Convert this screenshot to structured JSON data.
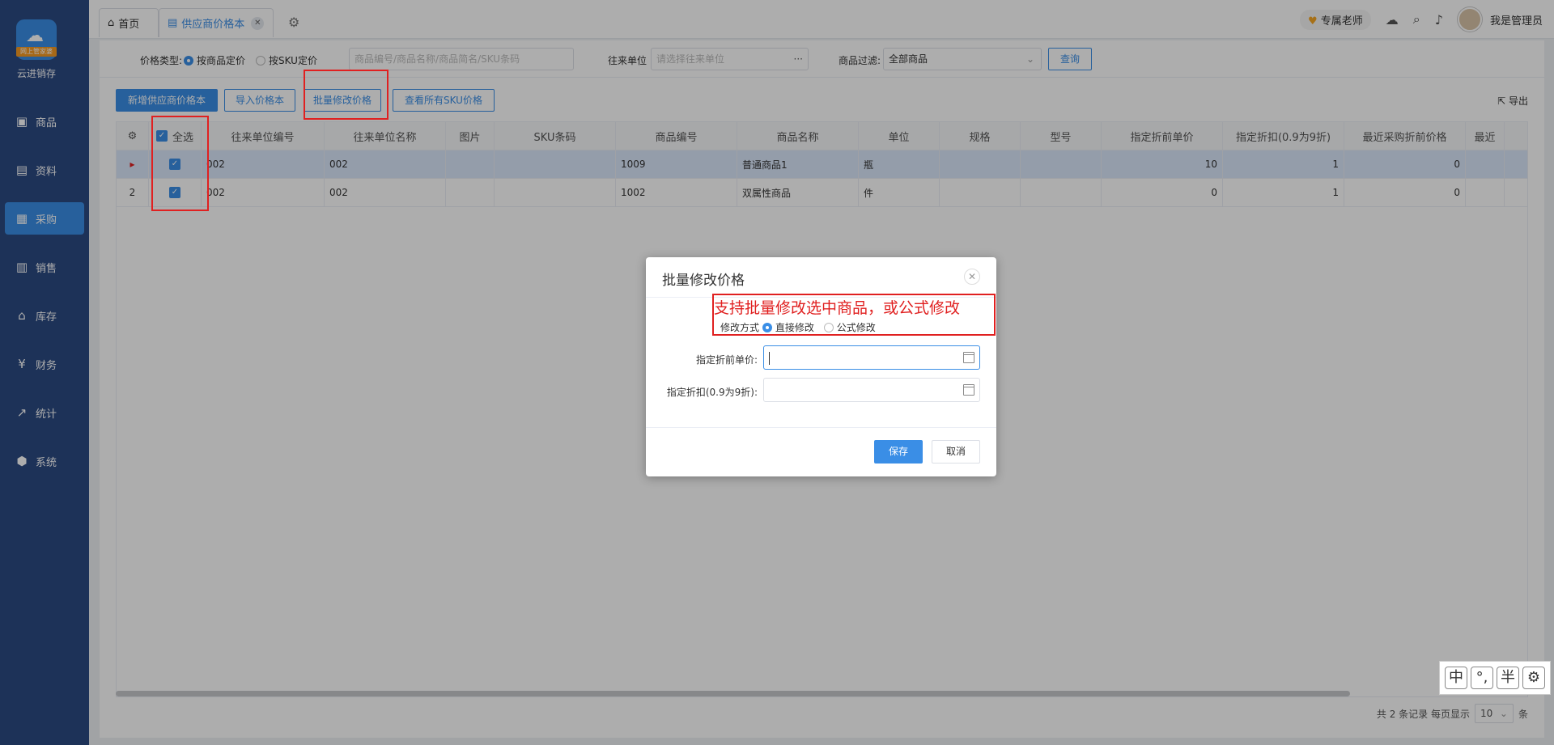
{
  "sidebar": {
    "logo_tag": "网上管家婆",
    "brand": "云进销存",
    "items": [
      {
        "label": "商品",
        "icon": "bag-icon"
      },
      {
        "label": "资料",
        "icon": "doc-icon"
      },
      {
        "label": "采购",
        "icon": "purchase-icon",
        "active": true
      },
      {
        "label": "销售",
        "icon": "chart-icon"
      },
      {
        "label": "库存",
        "icon": "warehouse-icon"
      },
      {
        "label": "财务",
        "icon": "finance-icon"
      },
      {
        "label": "统计",
        "icon": "stats-icon"
      },
      {
        "label": "系统",
        "icon": "system-icon"
      }
    ]
  },
  "tabs": {
    "home": "首页",
    "current": "供应商价格本"
  },
  "topbar": {
    "teacher": "专属老师",
    "user": "我是管理员"
  },
  "filter": {
    "price_type_label": "价格类型:",
    "opt_goods": "按商品定价",
    "opt_sku": "按SKU定价",
    "search_placeholder": "商品编号/商品名称/商品简名/SKU条码",
    "unit_label": "往来单位",
    "unit_placeholder": "请选择往来单位",
    "goods_filter_label": "商品过滤:",
    "goods_filter_value": "全部商品",
    "query": "查询"
  },
  "toolbar": {
    "add": "新增供应商价格本",
    "import": "导入价格本",
    "batch": "批量修改价格",
    "view_sku": "查看所有SKU价格",
    "export": "导出"
  },
  "table": {
    "select_all": "全选",
    "headers": [
      "往来单位编号",
      "往来单位名称",
      "图片",
      "SKU条码",
      "商品编号",
      "商品名称",
      "单位",
      "规格",
      "型号",
      "指定折前单价",
      "指定折扣(0.9为9折)",
      "最近采购折前价格",
      "最近"
    ],
    "rows": [
      {
        "idx": "▸",
        "unit_no": "002",
        "unit_name": "002",
        "sku": "",
        "code": "1009",
        "name": "普通商品1",
        "unit": "瓶",
        "spec": "",
        "model": "",
        "price": "10",
        "discount": "1",
        "last": "0"
      },
      {
        "idx": "2",
        "unit_no": "002",
        "unit_name": "002",
        "sku": "",
        "code": "1002",
        "name": "双属性商品",
        "unit": "件",
        "spec": "",
        "model": "",
        "price": "0",
        "discount": "1",
        "last": "0"
      }
    ]
  },
  "footer": {
    "total": "共 2 条记录",
    "per_page_label": "每页显示",
    "per_page": "10",
    "unit": "条"
  },
  "dialog": {
    "title": "批量修改价格",
    "annotation": "支持批量修改选中商品，或公式修改",
    "mode_label": "修改方式",
    "mode_direct": "直接修改",
    "mode_formula": "公式修改",
    "price_label": "指定折前单价:",
    "discount_label": "指定折扣(0.9为9折):",
    "save": "保存",
    "cancel": "取消"
  },
  "ime": [
    "中",
    "°,",
    "半",
    "⚙"
  ]
}
